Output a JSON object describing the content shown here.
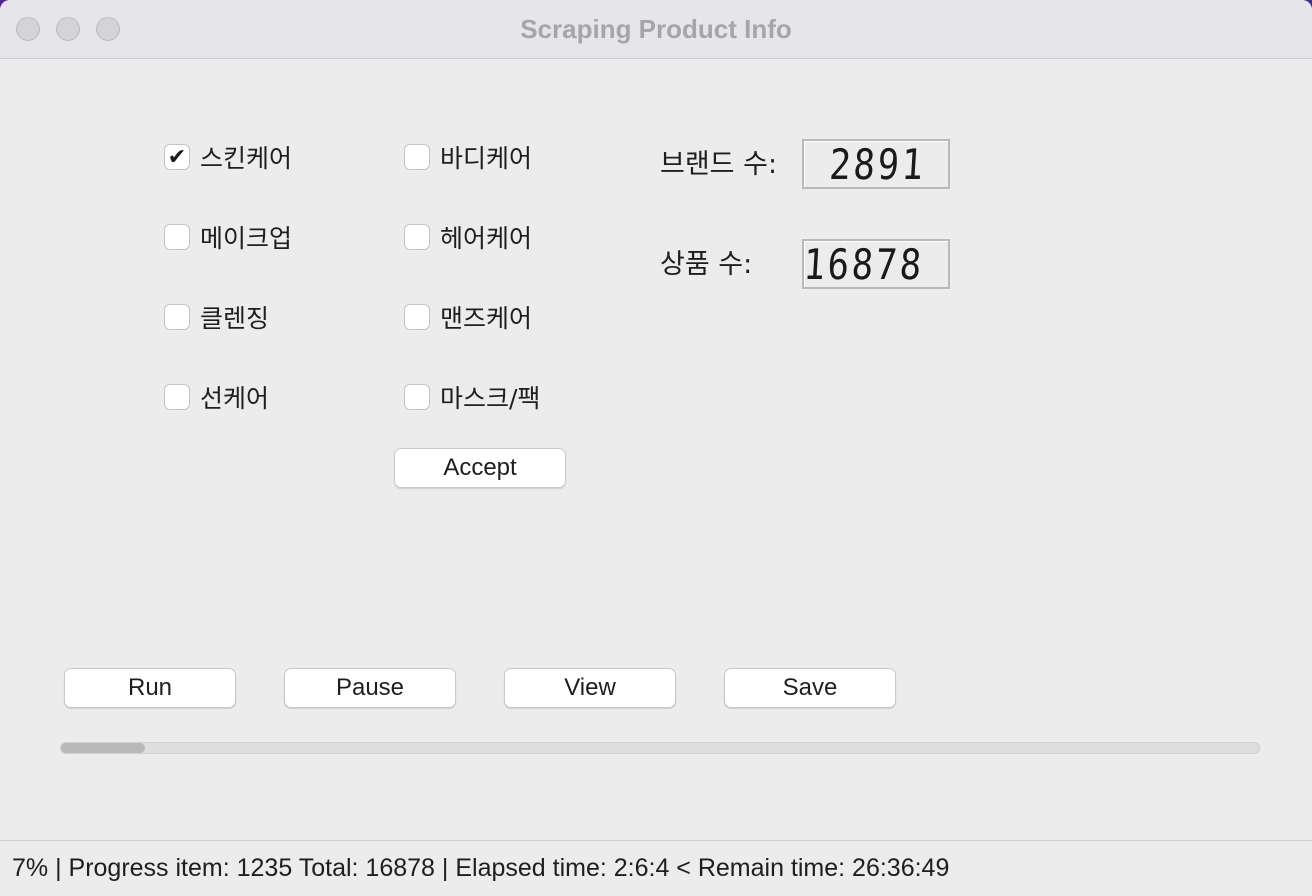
{
  "window": {
    "title": "Scraping Product Info"
  },
  "categories": [
    {
      "label": "스킨케어",
      "checked": true
    },
    {
      "label": "바디케어",
      "checked": false
    },
    {
      "label": "메이크업",
      "checked": false
    },
    {
      "label": "헤어케어",
      "checked": false
    },
    {
      "label": "클렌징",
      "checked": false
    },
    {
      "label": "맨즈케어",
      "checked": false
    },
    {
      "label": "선케어",
      "checked": false
    },
    {
      "label": "마스크/팩",
      "checked": false
    }
  ],
  "check_glyph": "✔",
  "accept_label": "Accept",
  "stats": {
    "brand_label": "브랜드 수:",
    "brand_value": "2891",
    "product_label": "상품 수:",
    "product_value": "16878"
  },
  "actions": {
    "run": "Run",
    "pause": "Pause",
    "view": "View",
    "save": "Save"
  },
  "progress": {
    "fraction": 0.07
  },
  "status": {
    "text": "7% | Progress item: 1235  Total: 16878 | Elapsed time: 2:6:4 < Remain time: 26:36:49"
  }
}
